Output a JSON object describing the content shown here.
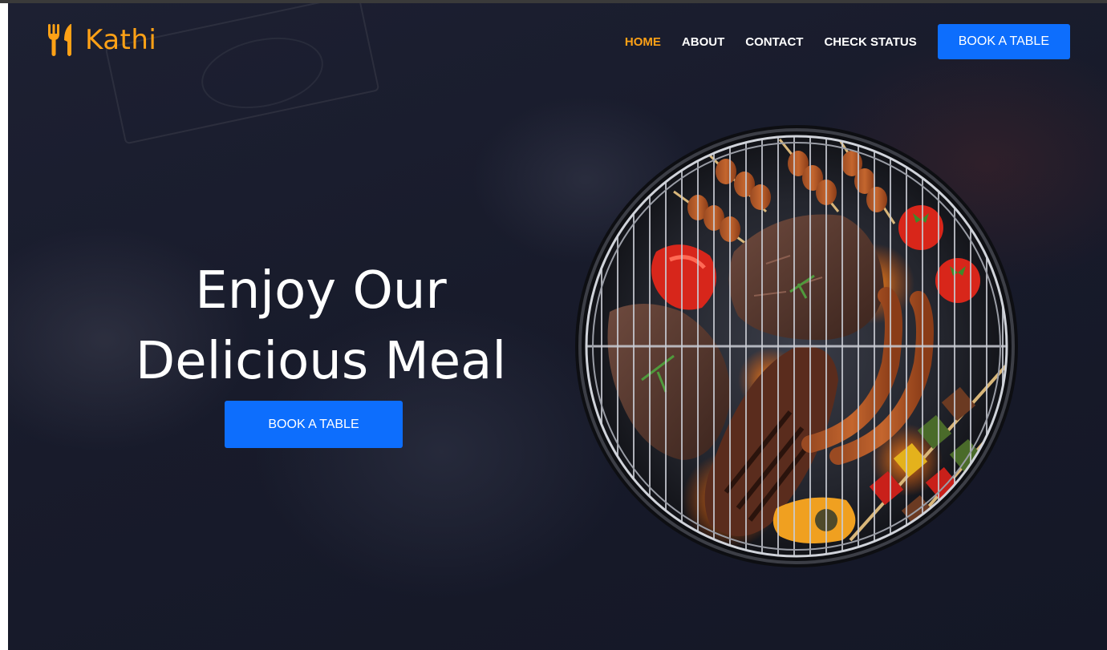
{
  "brand": {
    "name": "Kathi",
    "icon": "utensils-icon",
    "color": "#fea116"
  },
  "nav": {
    "items": [
      {
        "label": "HOME",
        "active": true
      },
      {
        "label": "ABOUT",
        "active": false
      },
      {
        "label": "CONTACT",
        "active": false
      },
      {
        "label": "CHECK STATUS",
        "active": false
      }
    ],
    "cta_label": "BOOK A TABLE"
  },
  "hero": {
    "headline_line1": "Enjoy Our",
    "headline_line2": "Delicious Meal",
    "cta_label": "BOOK A TABLE",
    "image": "grilled-bbq-image"
  },
  "colors": {
    "accent": "#fea116",
    "primary": "#0d6efd",
    "background": "#1a1d2e",
    "text": "#ffffff"
  }
}
